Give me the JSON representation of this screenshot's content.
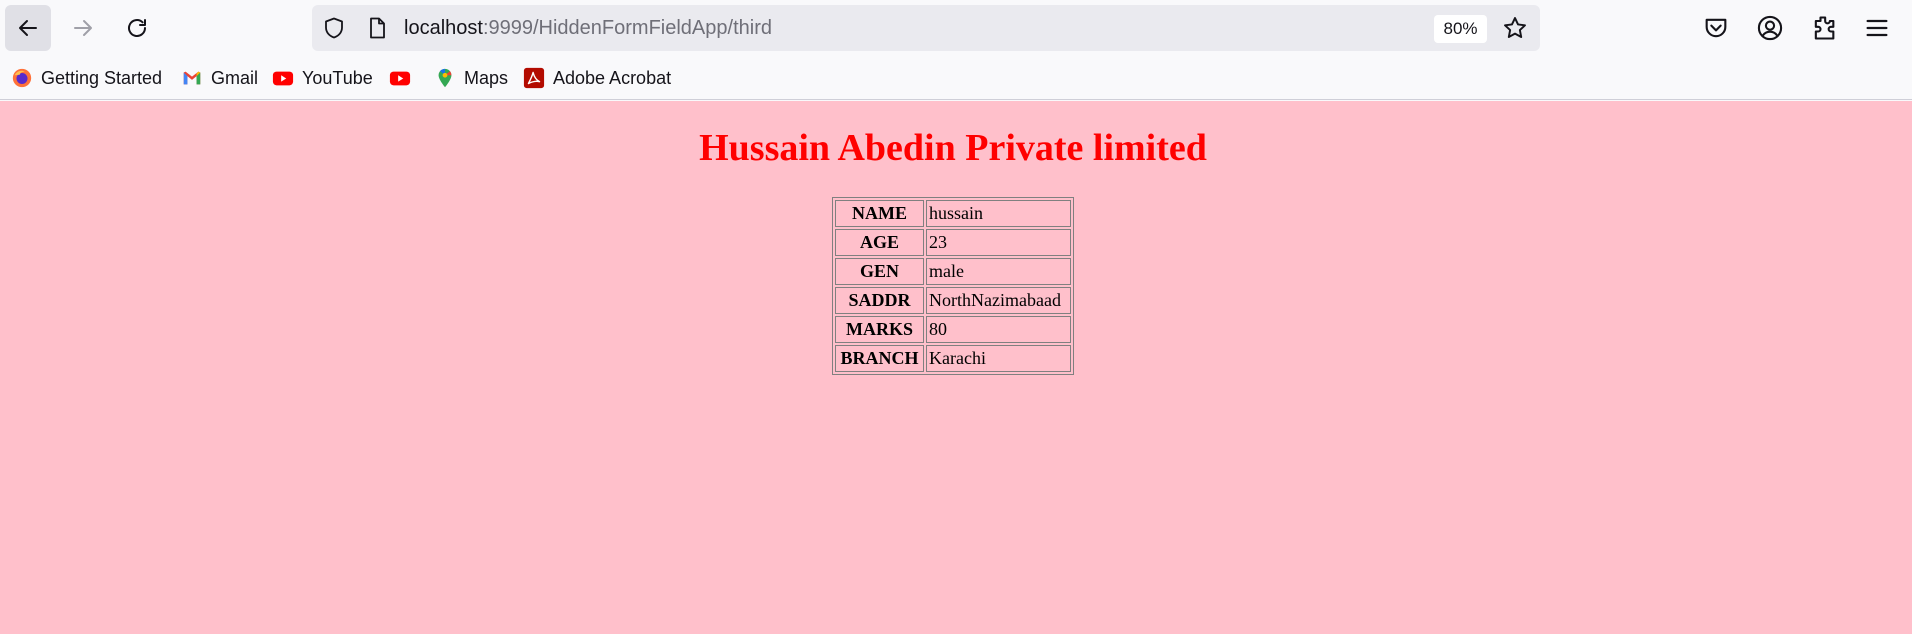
{
  "browser": {
    "url_host": "localhost",
    "url_path": ":9999/HiddenFormFieldApp/third",
    "zoom": "80%"
  },
  "bookmarks": [
    {
      "label": "Getting Started",
      "icon": "firefox-icon"
    },
    {
      "label": "Gmail",
      "icon": "gmail-icon"
    },
    {
      "label": "YouTube",
      "icon": "youtube-icon"
    },
    {
      "label": "",
      "icon": "youtube-icon"
    },
    {
      "label": "Maps",
      "icon": "maps-icon"
    },
    {
      "label": "Adobe Acrobat",
      "icon": "acrobat-icon"
    }
  ],
  "page": {
    "title": "Hussain Abedin Private limited",
    "background": "#ffc0cb",
    "title_color": "#ff0000",
    "rows": [
      {
        "label": "NAME",
        "value": "hussain"
      },
      {
        "label": "AGE",
        "value": "23"
      },
      {
        "label": "GEN",
        "value": "male"
      },
      {
        "label": "SADDR",
        "value": "NorthNazimabaad"
      },
      {
        "label": "MARKS",
        "value": "80"
      },
      {
        "label": "BRANCH",
        "value": "Karachi"
      }
    ]
  }
}
